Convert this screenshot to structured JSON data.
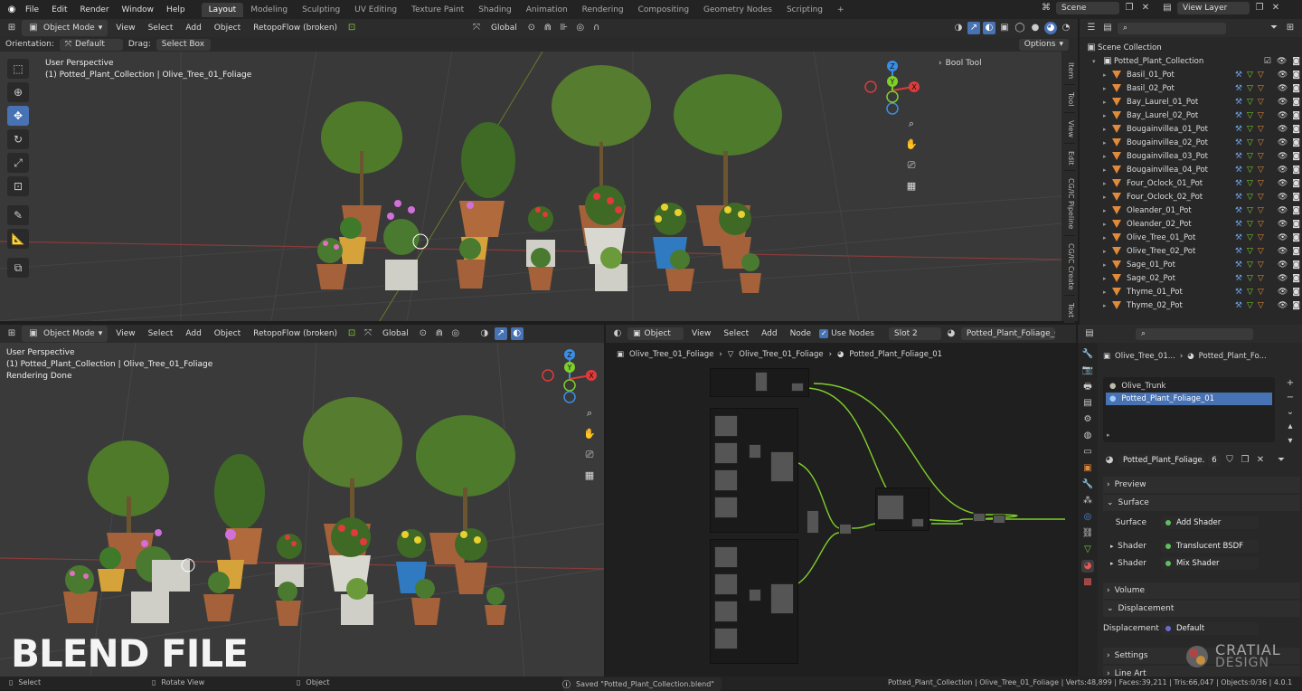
{
  "menu": [
    "File",
    "Edit",
    "Render",
    "Window",
    "Help"
  ],
  "workspaces": [
    "Layout",
    "Modeling",
    "Sculpting",
    "UV Editing",
    "Texture Paint",
    "Shading",
    "Animation",
    "Rendering",
    "Compositing",
    "Geometry Nodes",
    "Scripting"
  ],
  "active_workspace": "Layout",
  "add_workspace": "+",
  "scene": "Scene",
  "view_layer": "View Layer",
  "vp1": {
    "mode": "Object Mode",
    "menus": [
      "View",
      "Select",
      "Add",
      "Object"
    ],
    "addon": "RetopoFlow (broken)",
    "transform": "Global",
    "orientation_label": "Orientation:",
    "orientation_value": "Default",
    "drag_label": "Drag:",
    "drag_value": "Select Box",
    "options": "Options",
    "perspective": "User Perspective",
    "collection": "(1) Potted_Plant_Collection | Olive_Tree_01_Foliage",
    "bool_tool": "Bool Tool",
    "sidetabs": [
      "Item",
      "Tool",
      "View",
      "Edit",
      "CG/IC Pipeline",
      "CG/IC Create",
      "Text"
    ]
  },
  "vp2": {
    "mode": "Object Mode",
    "menus": [
      "View",
      "Select",
      "Add",
      "Object"
    ],
    "addon": "RetopoFlow (broken)",
    "transform": "Global",
    "perspective": "User Perspective",
    "collection": "(1) Potted_Plant_Collection | Olive_Tree_01_Foliage",
    "render_status": "Rendering Done"
  },
  "node_editor": {
    "type": "Object",
    "menus": [
      "View",
      "Select",
      "Add",
      "Node"
    ],
    "use_nodes": "Use Nodes",
    "slot": "Slot 2",
    "material": "Potted_Plant_Foliage_01",
    "breadcrumb": [
      "Olive_Tree_01_Foliage",
      "Olive_Tree_01_Foliage",
      "Potted_Plant_Foliage_01"
    ]
  },
  "outliner": {
    "root": "Scene Collection",
    "collection": "Potted_Plant_Collection",
    "items": [
      "Basil_01_Pot",
      "Basil_02_Pot",
      "Bay_Laurel_01_Pot",
      "Bay_Laurel_02_Pot",
      "Bougainvillea_01_Pot",
      "Bougainvillea_02_Pot",
      "Bougainvillea_03_Pot",
      "Bougainvillea_04_Pot",
      "Four_Oclock_01_Pot",
      "Four_Oclock_02_Pot",
      "Oleander_01_Pot",
      "Oleander_02_Pot",
      "Olive_Tree_01_Pot",
      "Olive_Tree_02_Pot",
      "Sage_01_Pot",
      "Sage_02_Pot",
      "Thyme_01_Pot",
      "Thyme_02_Pot"
    ]
  },
  "properties": {
    "breadcrumb_obj": "Olive_Tree_01...",
    "breadcrumb_mat": "Potted_Plant_Fo...",
    "slots": [
      "Olive_Trunk",
      "Potted_Plant_Foliage_01"
    ],
    "material_name": "Potted_Plant_Foliage...",
    "user_count": "6",
    "preview": "Preview",
    "surface": "Surface",
    "surface_label": "Surface",
    "surface_value": "Add Shader",
    "shader_label": "Shader",
    "shader1_value": "Translucent BSDF",
    "shader2_value": "Mix Shader",
    "volume": "Volume",
    "displacement": "Displacement",
    "displacement_label": "Displacement",
    "displacement_value": "Default",
    "settings": "Settings",
    "line_art": "Line Art"
  },
  "status_bar": {
    "select": "Select",
    "rotate": "Rotate View",
    "object": "Object",
    "saved": "Saved \"Potted_Plant_Collection.blend\"",
    "stats": "Potted_Plant_Collection | Olive_Tree_01_Foliage | Verts:48,899 | Faces:39,211 | Tris:66,047 | Objects:0/36 | 4.0.1"
  },
  "watermark": "BLEND FILE",
  "brand": "CRATIAL",
  "brand2": "DESIGN",
  "colors": {
    "accent": "#4772b3",
    "axis_x": "#e03a3a",
    "axis_y": "#7fcf2a",
    "axis_z": "#3b8ee6",
    "object_icon": "#e08a3c"
  }
}
